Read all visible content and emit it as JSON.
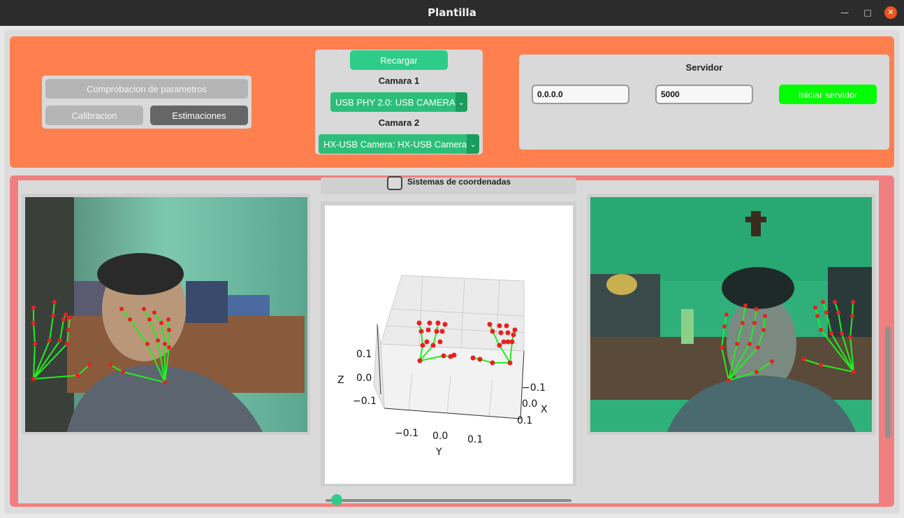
{
  "window": {
    "title": "Plantilla"
  },
  "controls": {
    "check_params_label": "Comprobacion de parametros",
    "calibration_label": "Calibracion",
    "estimations_label": "Estimaciones"
  },
  "cameras": {
    "reload_label": "Recargar",
    "camera1_label": "Camara 1",
    "camera1_value": "USB PHY 2.0: USB CAMERA",
    "camera2_label": "Camara 2",
    "camera2_value": "HX-USB Camera: HX-USB Camera"
  },
  "server": {
    "title": "Servidor",
    "ip_value": "0.0.0.0",
    "port_value": "5000",
    "start_label": "Iniciar servidor"
  },
  "viewer": {
    "coords_checkbox_label": "Sistemas de coordenadas",
    "coords_checked": false,
    "slider_value": 0
  },
  "plot": {
    "z_label": "Z",
    "y_label": "Y",
    "x_label": "X",
    "z_ticks": [
      "0.1",
      "0.0",
      "−0.1"
    ],
    "y_ticks": [
      "−0.1",
      "0.0",
      "0.1"
    ],
    "x_ticks": [
      "−0.1",
      "0.0",
      "0.1"
    ]
  },
  "icons": {
    "minimize": "minimize-icon",
    "maximize": "maximize-icon",
    "close": "close-icon",
    "dropdown": "chevron-down-icon"
  },
  "colors": {
    "top_panel": "#ff7f4f",
    "bottom_panel": "#f08080",
    "accent": "#2ecc88",
    "server_button": "#00ff00",
    "landmark": "#e82020",
    "skeleton": "#22ee22"
  }
}
